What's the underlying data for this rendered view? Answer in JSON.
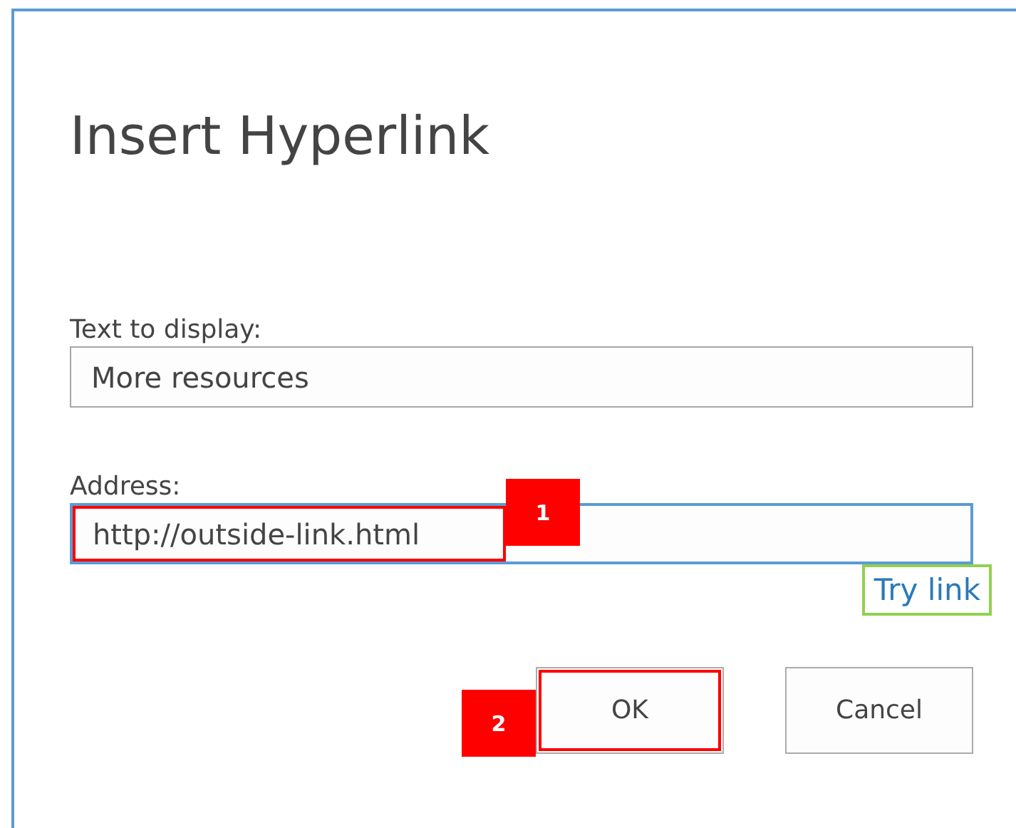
{
  "dialog": {
    "title": "Insert Hyperlink"
  },
  "fields": [
    {
      "label": "Text to display:",
      "value": "More resources",
      "focused": false
    },
    {
      "label": "Address:",
      "value": "http://outside-link.html",
      "focused": true,
      "highlight": {
        "color": "#ff0000",
        "badge": "1"
      }
    }
  ],
  "try_link": {
    "label": "Try link",
    "highlight": {
      "color": "#92d050"
    }
  },
  "buttons": [
    {
      "label": "OK",
      "highlight": {
        "color": "#ff0000",
        "badge": "2"
      }
    },
    {
      "label": "Cancel"
    }
  ]
}
